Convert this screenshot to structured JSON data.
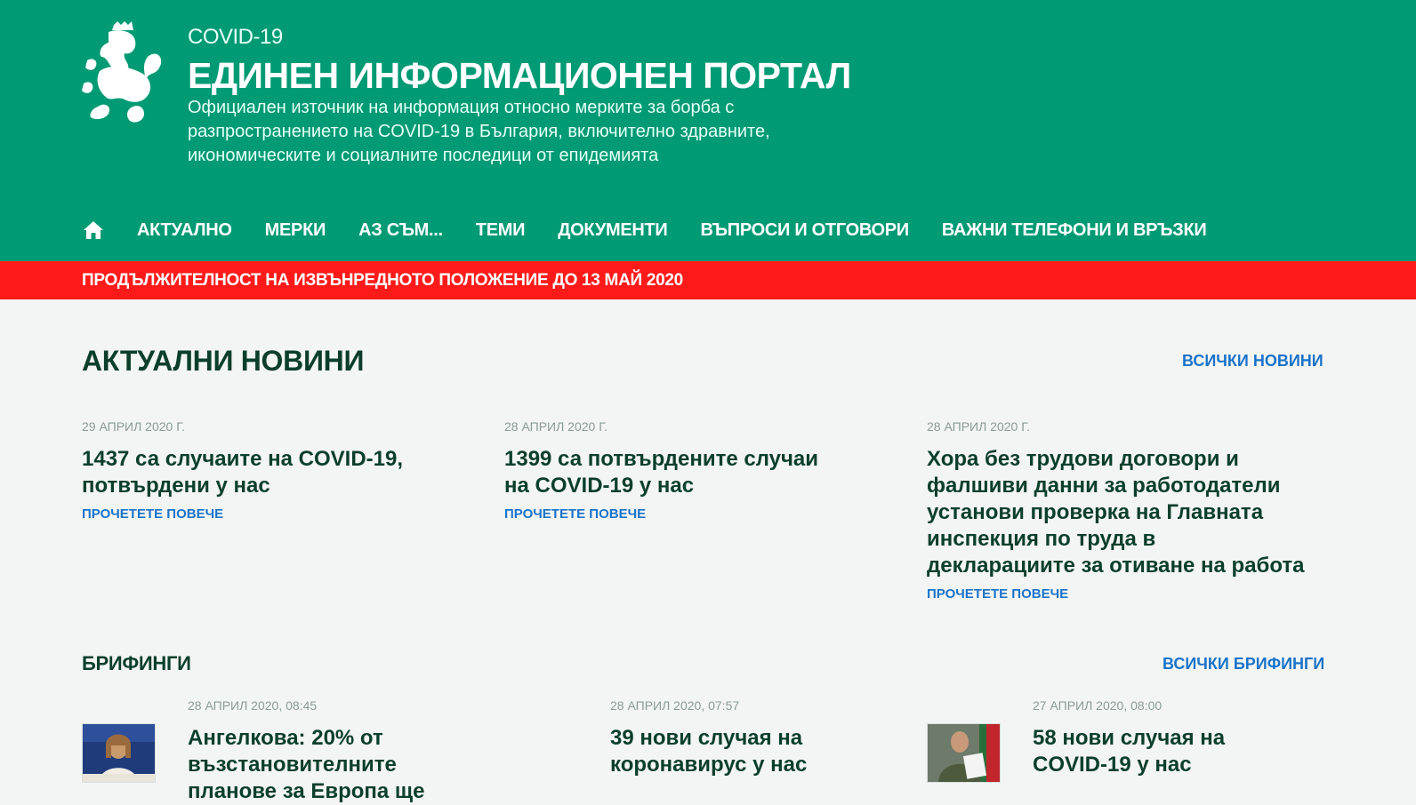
{
  "header": {
    "kicker": "COVID-19",
    "title": "ЕДИНЕН ИНФОРМАЦИОНЕН ПОРТАЛ",
    "description": "Официален източник на информация относно мерките за борба с разпространението на COVID-19 в България, включително здравните, икономическите и социалните последици от епидемията",
    "logo_icon": "lion-coat-of-arms-icon"
  },
  "nav": {
    "home_icon": "home-icon",
    "items": [
      {
        "label": "АКТУАЛНО"
      },
      {
        "label": "МЕРКИ"
      },
      {
        "label": "АЗ СЪМ..."
      },
      {
        "label": "ТЕМИ"
      },
      {
        "label": "ДОКУМЕНТИ"
      },
      {
        "label": "ВЪПРОСИ И ОТГОВОРИ"
      },
      {
        "label": "ВАЖНИ ТЕЛЕФОНИ И ВРЪЗКИ"
      }
    ]
  },
  "alert": {
    "text": "ПРОДЪЛЖИТЕЛНОСТ НА ИЗВЪНРЕДНОТО ПОЛОЖЕНИЕ ДО 13 МАЙ 2020"
  },
  "news": {
    "title": "АКТУАЛНИ НОВИНИ",
    "all_link": "ВСИЧКИ НОВИНИ",
    "items": [
      {
        "date": "29 АПРИЛ 2020 Г.",
        "title": "1437 са случаите на COVID-19, потвърдени у нас",
        "read_more": "ПРОЧЕТЕТЕ ПОВЕЧЕ"
      },
      {
        "date": "28 АПРИЛ 2020 Г.",
        "title": "1399 са потвърдените случаи на COVID-19 у нас",
        "read_more": "ПРОЧЕТЕТЕ ПОВЕЧЕ"
      },
      {
        "date": "28 АПРИЛ 2020 Г.",
        "title": "Хора без трудови договори и фалшиви данни за работодатели установи проверка на Главната инспекция по труда в декларациите за отиване на работа",
        "read_more": "ПРОЧЕТЕТЕ ПОВЕЧЕ"
      }
    ]
  },
  "briefings": {
    "title": "БРИФИНГИ",
    "all_link": "ВСИЧКИ БРИФИНГИ",
    "items": [
      {
        "date": "28 АПРИЛ 2020, 08:45",
        "title": "Ангелкова: 20% от възстановителните планове за Европа ще"
      },
      {
        "date": "28 АПРИЛ 2020, 07:57",
        "title": "39 нови случая на коронавирус у нас"
      },
      {
        "date": "27 АПРИЛ 2020, 08:00",
        "title": "58 нови случая на COVID-19 у нас"
      }
    ]
  },
  "colors": {
    "header_green": "#009a74",
    "alert_red": "#ff1a1a",
    "link_blue": "#1a73c9",
    "title_dark_green": "#0b3f2c"
  }
}
